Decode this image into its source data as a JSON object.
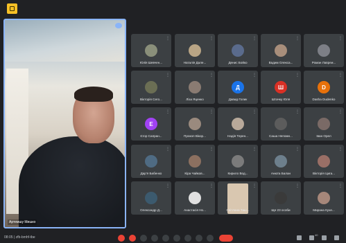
{
  "presenter": {
    "name": "Артемшу Мишко"
  },
  "tiles": [
    {
      "name": "Юлія Шевчен...",
      "avatar": "photo",
      "color": "#8a8f7a"
    },
    {
      "name": "Наталія Дале...",
      "avatar": "photo",
      "color": "#b9a585"
    },
    {
      "name": "Денис Бойко",
      "avatar": "photo",
      "color": "#5a6b8c"
    },
    {
      "name": "Вадим Олекса...",
      "avatar": "photo",
      "color": "#a88e7b"
    },
    {
      "name": "Роман Лавреи...",
      "avatar": "photo",
      "color": "#7d7f86"
    },
    {
      "name": "Вікторія Сего...",
      "avatar": "photo",
      "color": "#6b6e54"
    },
    {
      "name": "Ліза Яценко",
      "avatar": "photo",
      "color": "#8a7b72"
    },
    {
      "name": "Давид Голик",
      "avatar": "Д",
      "color": "#1a73e8"
    },
    {
      "name": "Штачку Юля",
      "avatar": "Ш",
      "color": "#d93025"
    },
    {
      "name": "Dasha Dudenko",
      "avatar": "D",
      "color": "#e8710a"
    },
    {
      "name": "Єгор Сапран...",
      "avatar": "Е",
      "color": "#a142f4"
    },
    {
      "name": "Прокоп Вікор...",
      "avatar": "photo",
      "color": "#9a8a7e"
    },
    {
      "name": "Надія Терен...",
      "avatar": "photo",
      "color": "#b8a99a"
    },
    {
      "name": "Саша Непомн...",
      "avatar": "photo",
      "color": "#5c5c5c"
    },
    {
      "name": "Іван Орел",
      "avatar": "photo",
      "color": "#7a6a66"
    },
    {
      "name": "Дар'я Бабенко",
      "avatar": "photo",
      "color": "#4f6b83"
    },
    {
      "name": "Кіра Чайков...",
      "avatar": "photo",
      "color": "#8c7060"
    },
    {
      "name": "Кирило Вод...",
      "avatar": "photo",
      "color": "#7b7b7b"
    },
    {
      "name": "Анюта Балан",
      "avatar": "photo",
      "color": "#6d7f8c"
    },
    {
      "name": "Вікторія Цига...",
      "avatar": "photo",
      "color": "#9a6f66"
    },
    {
      "name": "Олександр Д...",
      "avatar": "photo",
      "color": "#3c5a6e"
    },
    {
      "name": "Анастасія Но...",
      "avatar": "photo",
      "color": "#e0e0e0"
    },
    {
      "name": "Світлана Таш...",
      "avatar": "video",
      "color": "#d9c7b0"
    },
    {
      "name": "Ще 23 особи",
      "avatar": "photo",
      "color": "#3a3a3a"
    },
    {
      "name": "Мирана Кухе...",
      "avatar": "photo",
      "color": "#a6877a"
    }
  ],
  "bottom_bar": {
    "time_text": "08:05 | zfb-bmhf-tbe",
    "participants_count": "40"
  }
}
